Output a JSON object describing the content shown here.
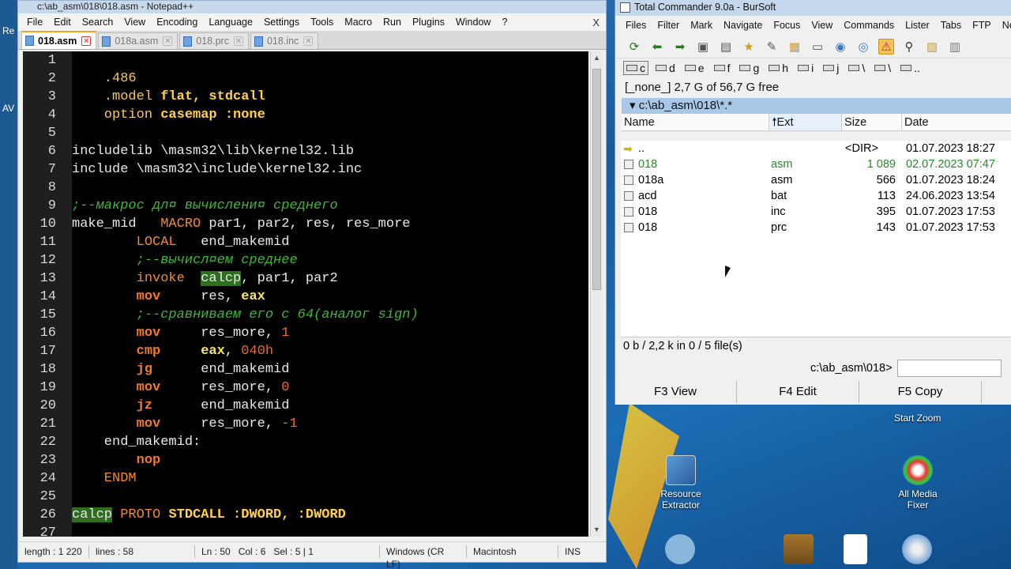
{
  "desktop": {
    "left_labels": [
      "Re",
      "AV"
    ],
    "start_zoom": "Start Zoom",
    "icons": [
      {
        "label1": "Resource",
        "label2": "Extractor",
        "icon": "resource-extractor-icon"
      },
      {
        "label1": "All Media",
        "label2": "Fixer",
        "icon": "all-media-fixer-icon"
      }
    ]
  },
  "notepad": {
    "title": "c:\\ab_asm\\018\\018.asm - Notepad++",
    "menu": [
      "File",
      "Edit",
      "Search",
      "View",
      "Encoding",
      "Language",
      "Settings",
      "Tools",
      "Macro",
      "Run",
      "Plugins",
      "Window",
      "?"
    ],
    "close": "X",
    "tabs": [
      "018.asm",
      "018a.asm",
      "018.prc",
      "018.inc"
    ],
    "status": {
      "length": "length : 1 220",
      "lines": "lines : 58",
      "pos": "Ln : 50   Col : 6   Sel : 5 | 1",
      "eol": "Windows (CR LF)",
      "encoding": "Macintosh",
      "mode": "INS"
    },
    "lines": [
      {
        "n": "1",
        "tokens": []
      },
      {
        "n": "2",
        "tokens": [
          {
            "c": "t-dir",
            "t": "    .486"
          }
        ]
      },
      {
        "n": "3",
        "tokens": [
          {
            "c": "t-dir",
            "t": "    .model "
          },
          {
            "c": "t-kw",
            "t": "flat, stdcall"
          }
        ]
      },
      {
        "n": "4",
        "tokens": [
          {
            "c": "t-dir",
            "t": "    option "
          },
          {
            "c": "t-kw",
            "t": "casemap :none"
          }
        ]
      },
      {
        "n": "5",
        "tokens": []
      },
      {
        "n": "6",
        "tokens": [
          {
            "c": "t-plain",
            "t": "includelib \\masm32\\lib\\kernel32.lib"
          }
        ]
      },
      {
        "n": "7",
        "tokens": [
          {
            "c": "t-plain",
            "t": "include \\masm32\\include\\kernel32.inc"
          }
        ]
      },
      {
        "n": "8",
        "tokens": []
      },
      {
        "n": "9",
        "tokens": [
          {
            "c": "t-com",
            "t": ";--макрос дл¤ вычислени¤ среднего"
          }
        ]
      },
      {
        "n": "10",
        "tokens": [
          {
            "c": "t-plain",
            "t": "make_mid   "
          },
          {
            "c": "t-macro",
            "t": "MACRO"
          },
          {
            "c": "t-plain",
            "t": " par1, par2, res, res_more"
          }
        ]
      },
      {
        "n": "11",
        "tokens": [
          {
            "c": "t-local",
            "t": "        LOCAL"
          },
          {
            "c": "t-plain",
            "t": "   end_makemid"
          }
        ]
      },
      {
        "n": "12",
        "tokens": [
          {
            "c": "t-com",
            "t": "        ;--вычисл¤ем среднее"
          }
        ]
      },
      {
        "n": "13",
        "tokens": [
          {
            "c": "t-macro",
            "t": "        invoke"
          },
          {
            "c": "t-plain",
            "t": "  "
          },
          {
            "c": "t-hl",
            "t": "calcp"
          },
          {
            "c": "t-plain",
            "t": ", par1, par2"
          }
        ]
      },
      {
        "n": "14",
        "tokens": [
          {
            "c": "t-instr",
            "t": "        mov"
          },
          {
            "c": "t-plain",
            "t": "     res, "
          },
          {
            "c": "t-reg",
            "t": "eax"
          }
        ]
      },
      {
        "n": "15",
        "tokens": [
          {
            "c": "t-com",
            "t": "        ;--сравниваем его с 64(аналог sign)"
          }
        ]
      },
      {
        "n": "16",
        "tokens": [
          {
            "c": "t-instr",
            "t": "        mov"
          },
          {
            "c": "t-plain",
            "t": "     res_more, "
          },
          {
            "c": "t-num",
            "t": "1"
          }
        ]
      },
      {
        "n": "17",
        "tokens": [
          {
            "c": "t-instr",
            "t": "        cmp"
          },
          {
            "c": "t-plain",
            "t": "     "
          },
          {
            "c": "t-reg",
            "t": "eax"
          },
          {
            "c": "t-plain",
            "t": ", "
          },
          {
            "c": "t-num",
            "t": "040h"
          }
        ]
      },
      {
        "n": "18",
        "tokens": [
          {
            "c": "t-instr",
            "t": "        jg"
          },
          {
            "c": "t-plain",
            "t": "      end_makemid"
          }
        ]
      },
      {
        "n": "19",
        "tokens": [
          {
            "c": "t-instr",
            "t": "        mov"
          },
          {
            "c": "t-plain",
            "t": "     res_more, "
          },
          {
            "c": "t-num",
            "t": "0"
          }
        ]
      },
      {
        "n": "20",
        "tokens": [
          {
            "c": "t-instr",
            "t": "        jz"
          },
          {
            "c": "t-plain",
            "t": "      end_makemid"
          }
        ]
      },
      {
        "n": "21",
        "tokens": [
          {
            "c": "t-instr",
            "t": "        mov"
          },
          {
            "c": "t-plain",
            "t": "     res_more, "
          },
          {
            "c": "t-num",
            "t": "-1"
          }
        ]
      },
      {
        "n": "22",
        "tokens": [
          {
            "c": "t-plain",
            "t": "    end_makemid:"
          }
        ]
      },
      {
        "n": "23",
        "tokens": [
          {
            "c": "t-instr",
            "t": "        nop"
          }
        ]
      },
      {
        "n": "24",
        "tokens": [
          {
            "c": "t-macro",
            "t": "    ENDM"
          }
        ]
      },
      {
        "n": "25",
        "tokens": []
      },
      {
        "n": "26",
        "tokens": [
          {
            "c": "t-hl",
            "t": "calcp"
          },
          {
            "c": "t-plain",
            "t": " "
          },
          {
            "c": "t-macro",
            "t": "PROTO"
          },
          {
            "c": "t-plain",
            "t": " "
          },
          {
            "c": "t-kw",
            "t": "STDCALL :DWORD, :DWORD"
          }
        ]
      },
      {
        "n": "27",
        "tokens": []
      }
    ]
  },
  "tc": {
    "title": "Total Commander 9.0a - BurSoft",
    "menu": [
      "Files",
      "Filter",
      "Mark",
      "Navigate",
      "Focus",
      "View",
      "Commands",
      "Lister",
      "Tabs",
      "FTP",
      "Net"
    ],
    "drives": [
      "c",
      "d",
      "e",
      "f",
      "g",
      "h",
      "i",
      "j",
      "\\",
      "\\",
      ".."
    ],
    "diskinfo": "[_none_]  2,7 G of 56,7 G free",
    "path": "c:\\ab_asm\\018\\*.*",
    "path_star": "*",
    "columns": {
      "name": "Name",
      "ext": "Ext",
      "size": "Size",
      "date": "Date"
    },
    "sort_arrow": "🠕",
    "files": [
      {
        "name": "..",
        "ext": "",
        "size": "<DIR>",
        "date": "01.07.2023 18:27",
        "green": false,
        "up": true
      },
      {
        "name": "018",
        "ext": "asm",
        "size": "1 089",
        "date": "02.07.2023 07:47",
        "green": true,
        "up": false
      },
      {
        "name": "018a",
        "ext": "asm",
        "size": "566",
        "date": "01.07.2023 18:24",
        "green": false,
        "up": false
      },
      {
        "name": "acd",
        "ext": "bat",
        "size": "113",
        "date": "24.06.2023 13:54",
        "green": false,
        "up": false
      },
      {
        "name": "018",
        "ext": "inc",
        "size": "395",
        "date": "01.07.2023 17:53",
        "green": false,
        "up": false
      },
      {
        "name": "018",
        "ext": "prc",
        "size": "143",
        "date": "01.07.2023 17:53",
        "green": false,
        "up": false
      }
    ],
    "selinfo": "0 b / 2,2 k in 0 / 5 file(s)",
    "prompt": "c:\\ab_asm\\018>",
    "fkeys": [
      "F3 View",
      "F4 Edit",
      "F5 Copy"
    ]
  }
}
